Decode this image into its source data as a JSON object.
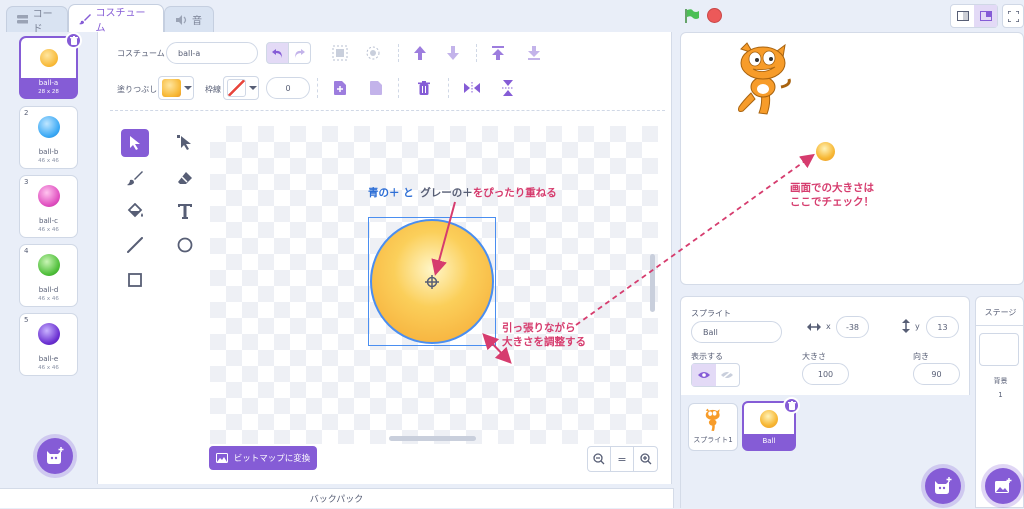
{
  "tabs": [
    {
      "label": "コード"
    },
    {
      "label": "コスチューム"
    },
    {
      "label": "音"
    }
  ],
  "costumes": [
    {
      "num": "1",
      "name": "ball-a",
      "size": "28 x 28",
      "color": "#f7b733"
    },
    {
      "num": "2",
      "name": "ball-b",
      "size": "46 x 46",
      "color": "#3ba9f5"
    },
    {
      "num": "3",
      "name": "ball-c",
      "size": "46 x 46",
      "color": "#e04fc0"
    },
    {
      "num": "4",
      "name": "ball-d",
      "size": "46 x 46",
      "color": "#4fbf3a"
    },
    {
      "num": "5",
      "name": "ball-e",
      "size": "46 x 46",
      "color": "#6a2fd1"
    }
  ],
  "editor": {
    "costume_label": "コスチューム",
    "costume_name": "ball-a",
    "fill_label": "塗りつぶし",
    "outline_label": "枠線",
    "outline_width": "0",
    "convert_button": "ビットマップに変換",
    "zoom_reset": "="
  },
  "annotations": {
    "blue_plus": "青の＋",
    "and": "と",
    "grey_plus": "グレーの＋",
    "align_text": "をぴったり重ねる",
    "resize_line1": "引っ張りながら",
    "resize_line2": "大きさを調整する",
    "stage_line1": "画面での大きさは",
    "stage_line2": "ここでチェック！"
  },
  "sprite_info": {
    "sprite_label": "スプライト",
    "name": "Ball",
    "x_label": "x",
    "x": "-38",
    "y_label": "y",
    "y": "13",
    "show_label": "表示する",
    "size_label": "大きさ",
    "size": "100",
    "direction_label": "向き",
    "direction": "90"
  },
  "sprites": [
    {
      "name": "スプライト1"
    },
    {
      "name": "Ball"
    }
  ],
  "stage_panel": {
    "title": "ステージ",
    "backdrop_label": "背景",
    "backdrop_count": "1"
  },
  "backpack": "バックパック",
  "colors": {
    "accent": "#855cd6",
    "annotation": "#d63c6e",
    "blue_annotation": "#2e6fd6",
    "ball": "#f7b733"
  }
}
